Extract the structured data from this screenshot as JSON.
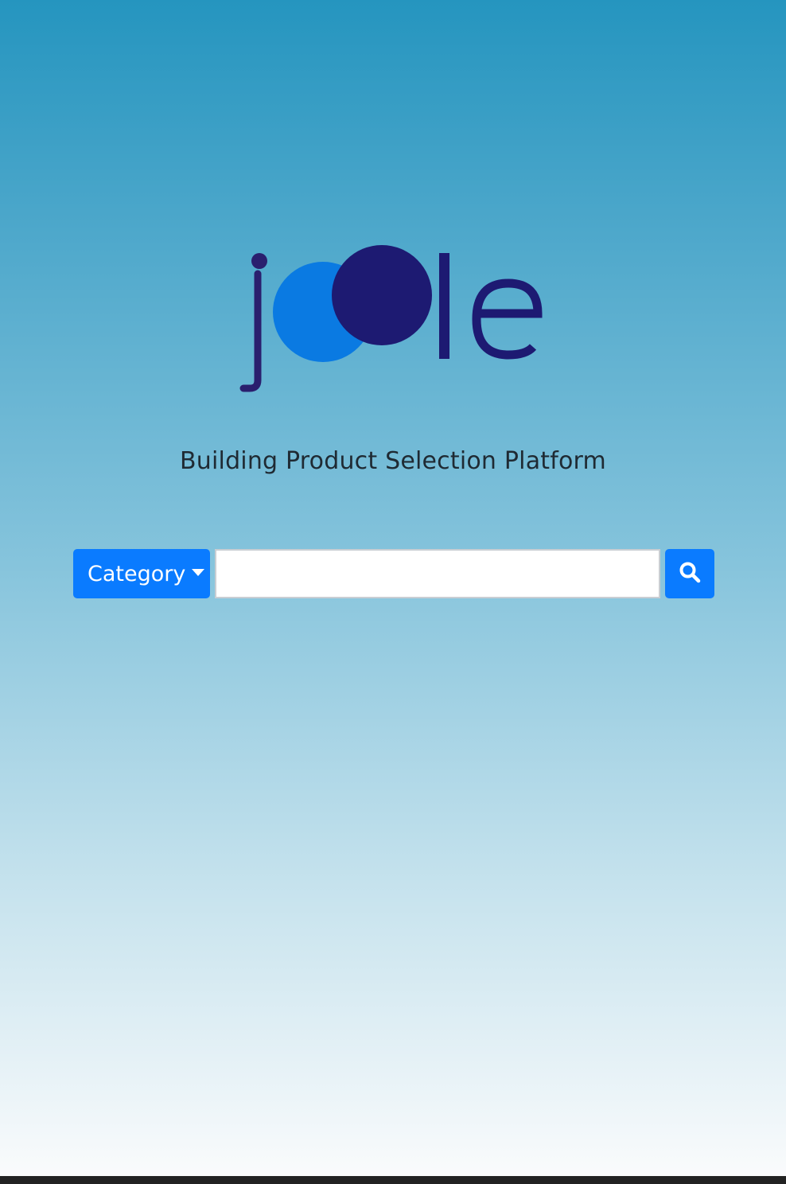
{
  "logo": {
    "text": "joole"
  },
  "tagline": "Building Product Selection Platform",
  "search": {
    "category_label": "Category",
    "input_value": "",
    "button_icon": "search-icon"
  },
  "colors": {
    "primary_button": "#0a7bff",
    "logo_dark": "#1d1a72",
    "logo_light": "#0a7ae2",
    "gradient_top": "#2595bf",
    "gradient_bottom": "#fafbfc"
  }
}
